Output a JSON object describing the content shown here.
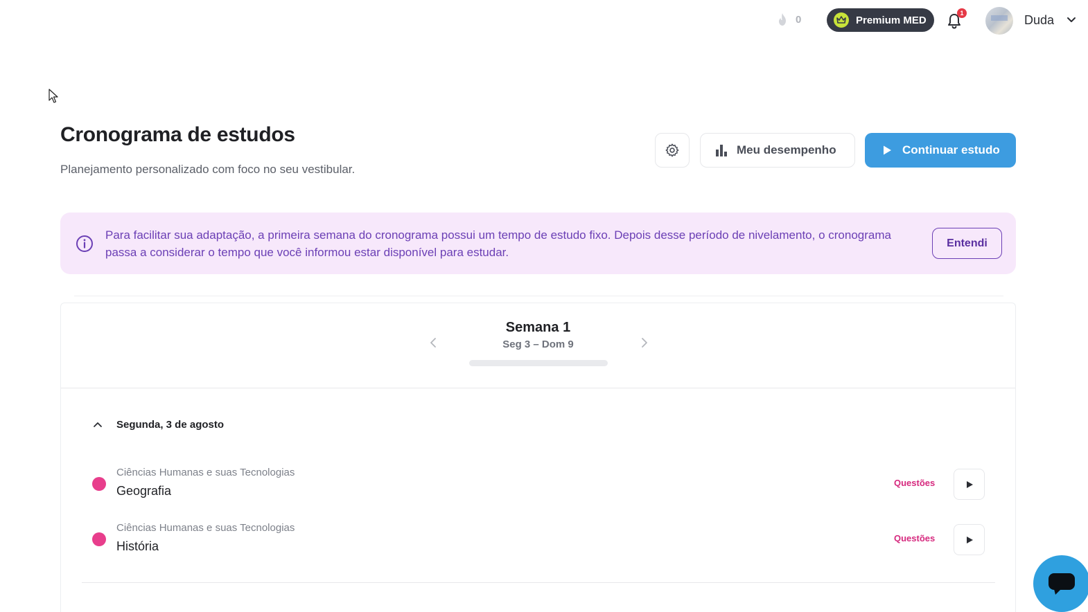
{
  "topbar": {
    "streak_count": "0",
    "premium_label": "Premium MED",
    "notification_count": "1",
    "user_name": "Duda"
  },
  "header": {
    "title": "Cronograma de estudos",
    "subtitle": "Planejamento personalizado com foco no seu vestibular.",
    "performance_label": "Meu desempenho",
    "continue_label": "Continuar estudo"
  },
  "banner": {
    "text": "Para facilitar sua adaptação, a primeira semana do cronograma possui um tempo de estudo fixo. Depois desse período de nivelamento, o cronograma passa a considerar o tempo que você informou estar disponível para estudar.",
    "button_label": "Entendi"
  },
  "week": {
    "title": "Semana 1",
    "range": "Seg 3 – Dom 9",
    "progress": 0
  },
  "day": {
    "title": "Segunda, 3 de agosto",
    "tasks": [
      {
        "area": "Ciências Humanas e suas Tecnologias",
        "subject": "Geografia",
        "type": "Questões",
        "color": "#e83e8c"
      },
      {
        "area": "Ciências Humanas e suas Tecnologias",
        "subject": "História",
        "type": "Questões",
        "color": "#e83e8c"
      }
    ]
  },
  "colors": {
    "primary": "#3d9ce0",
    "banner_bg": "#f7e8fb",
    "banner_text": "#6b3fb5",
    "accent_pink": "#d6297e",
    "premium_bg": "#363a45"
  }
}
